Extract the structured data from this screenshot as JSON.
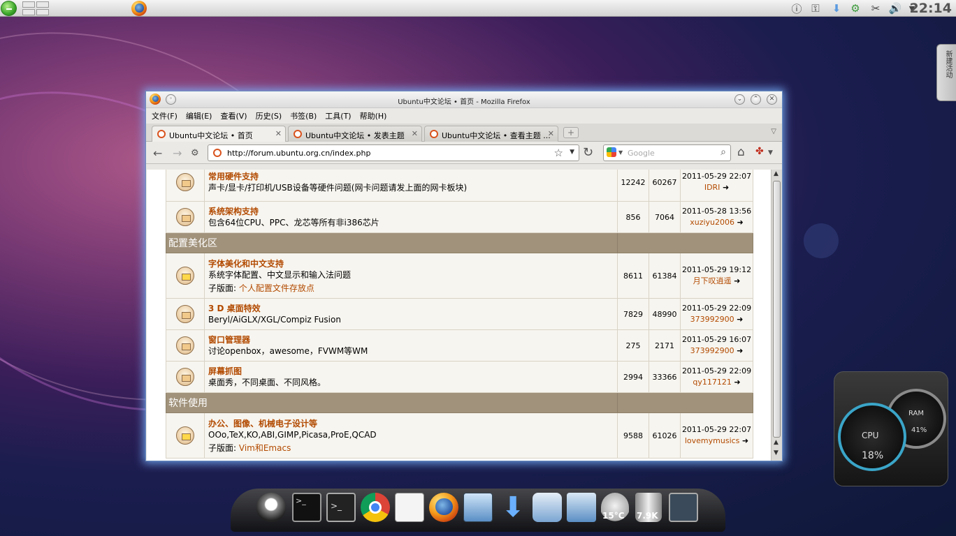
{
  "panel": {
    "clock": "22:14"
  },
  "activity_tab": "新建活动",
  "window": {
    "title": "Ubuntu中文论坛 • 首页 - Mozilla Firefox",
    "menu": [
      "文件(F)",
      "编辑(E)",
      "查看(V)",
      "历史(S)",
      "书签(B)",
      "工具(T)",
      "帮助(H)"
    ],
    "tabs": [
      "Ubuntu中文论坛 • 首页",
      "Ubuntu中文论坛 • 发表主题",
      "Ubuntu中文论坛 • 查看主题 ..."
    ],
    "url": "http://forum.ubuntu.org.cn/index.php",
    "search_placeholder": "Google"
  },
  "forum": {
    "row1": {
      "title": "常用硬件支持",
      "desc": "声卡/显卡/打印机/USB设备等硬件问题(网卡问题请发上面的网卡板块)",
      "topics": "12242",
      "posts": "60267",
      "date": "2011-05-29 22:07",
      "author": "IDRI"
    },
    "row2": {
      "title": "系统架构支持",
      "desc": "包含64位CPU、PPC、龙芯等所有非i386芯片",
      "topics": "856",
      "posts": "7064",
      "date": "2011-05-28 13:56",
      "author": "xuziyu2006"
    },
    "cat1": "配置美化区",
    "row3": {
      "title": "字体美化和中文支持",
      "desc": "系统字体配置、中文显示和输入法问题",
      "sub_label": "子版面:",
      "sub": "个人配置文件存放点",
      "topics": "8611",
      "posts": "61384",
      "date": "2011-05-29 19:12",
      "author": "月下叹逍遥"
    },
    "row4": {
      "title": "3 D 桌面特效",
      "desc": "Beryl/AiGLX/XGL/Compiz Fusion",
      "topics": "7829",
      "posts": "48990",
      "date": "2011-05-29 22:09",
      "author": "373992900"
    },
    "row5": {
      "title": "窗口管理器",
      "desc": "讨论openbox，awesome，FVWM等WM",
      "topics": "275",
      "posts": "2171",
      "date": "2011-05-29 16:07",
      "author": "373992900"
    },
    "row6": {
      "title": "屏幕抓图",
      "desc": "桌面秀，不同桌面、不同风格。",
      "topics": "2994",
      "posts": "33366",
      "date": "2011-05-29 22:09",
      "author": "qy117121"
    },
    "cat2": "软件使用",
    "row7": {
      "title": "办公、图像、机械电子设计等",
      "desc": "OOo,TeX,KO,ABI,GIMP,Picasa,ProE,QCAD",
      "sub_label": "子版面:",
      "sub": "Vim和Emacs",
      "topics": "9588",
      "posts": "61026",
      "date": "2011-05-29 22:07",
      "author": "lovemymusics"
    }
  },
  "dock": {
    "weather": "15°C",
    "trash": "7.9K"
  },
  "gauges": {
    "cpu_label": "CPU",
    "cpu_value": "18%",
    "ram_label": "RAM",
    "ram_value": "41%"
  }
}
